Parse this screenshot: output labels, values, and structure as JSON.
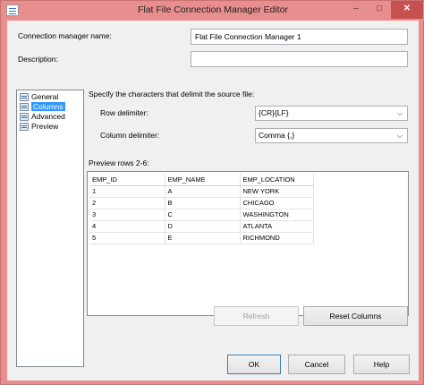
{
  "window": {
    "title": "Flat File Connection Manager Editor",
    "minimize_glyph": "–",
    "maximize_glyph": "□",
    "close_glyph": "✕"
  },
  "form": {
    "name_label": "Connection manager name:",
    "name_value": "Flat File Connection Manager 1",
    "description_label": "Description:",
    "description_value": ""
  },
  "nav": {
    "items": [
      {
        "label": "General",
        "icon": "general-icon"
      },
      {
        "label": "Columns",
        "icon": "columns-icon",
        "selected": true
      },
      {
        "label": "Advanced",
        "icon": "advanced-icon"
      },
      {
        "label": "Preview",
        "icon": "preview-icon"
      }
    ]
  },
  "delimiters": {
    "heading": "Specify the characters that delimit the source file:",
    "row_label": "Row delimiter:",
    "row_value": "{CR}{LF}",
    "column_label": "Column delimiter:",
    "column_value": "Comma {,}"
  },
  "preview": {
    "label": "Preview rows 2-6:",
    "columns": [
      "EMP_ID",
      "EMP_NAME",
      "EMP_LOCATION"
    ],
    "rows": [
      [
        "1",
        "A",
        "NEW YORK"
      ],
      [
        "2",
        "B",
        "CHICAGO"
      ],
      [
        "3",
        "C",
        "WASHINGTON"
      ],
      [
        "4",
        "D",
        "ATLANTA"
      ],
      [
        "5",
        "E",
        "RICHMOND"
      ]
    ]
  },
  "buttons": {
    "refresh": "Refresh",
    "reset_columns": "Reset Columns",
    "ok": "OK",
    "cancel": "Cancel",
    "help": "Help"
  },
  "colors": {
    "title_bar": "#e98e8e",
    "close_button": "#c75050",
    "selection": "#3399ff"
  }
}
